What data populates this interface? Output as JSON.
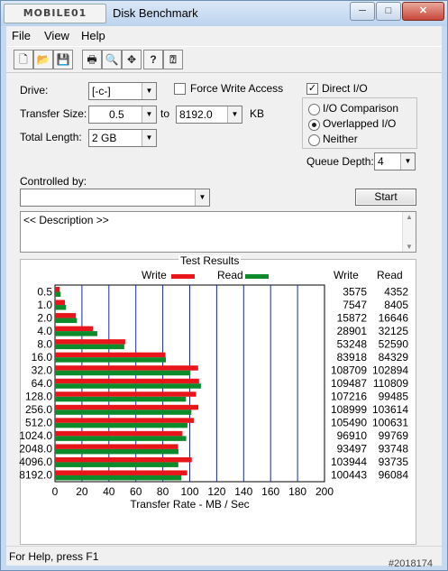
{
  "window": {
    "logo_text": "MOBILE01",
    "title": "Disk Benchmark",
    "controls": {
      "minimize": "─",
      "maximize": "□",
      "close": "✕"
    }
  },
  "menu": [
    "File",
    "View",
    "Help"
  ],
  "toolbar": {
    "icons": [
      "new-icon",
      "open-icon",
      "save-icon",
      "print-icon",
      "print-preview-icon",
      "move-icon",
      "help-icon",
      "context-help-icon"
    ],
    "glyphs": [
      "🗋",
      "📂",
      "💾",
      "🖶",
      "🔍",
      "✥",
      "?",
      "⍰"
    ]
  },
  "settings": {
    "drive_label": "Drive:",
    "drive_value": "[-c-]",
    "transfer_size_label": "Transfer Size:",
    "transfer_from": "0.5",
    "to_label": "to",
    "transfer_to": "8192.0",
    "kb_label": "KB",
    "total_length_label": "Total Length:",
    "total_length_value": "2 GB",
    "force_write_access_label": "Force Write Access",
    "force_write_access_checked": false,
    "direct_io_label": "Direct I/O",
    "direct_io_checked": true,
    "io_options": [
      {
        "label": "I/O Comparison",
        "selected": false
      },
      {
        "label": "Overlapped I/O",
        "selected": true
      },
      {
        "label": "Neither",
        "selected": false
      }
    ],
    "queue_depth_label": "Queue Depth:",
    "queue_depth_value": "4",
    "controlled_by_label": "Controlled by:",
    "controlled_by_value": "",
    "start_label": "Start",
    "description_text": "<< Description >>"
  },
  "results": {
    "group_title": "Test Results",
    "write_label": "Write",
    "read_label": "Read",
    "write_color": "#e8151b",
    "read_color": "#0d8a2a",
    "col_write_header": "Write",
    "col_read_header": "Read",
    "x_axis_label": "Transfer Rate - MB / Sec"
  },
  "chart_data": {
    "type": "bar",
    "orientation": "horizontal",
    "categories": [
      "0.5",
      "1.0",
      "2.0",
      "4.0",
      "8.0",
      "16.0",
      "32.0",
      "64.0",
      "128.0",
      "256.0",
      "512.0",
      "1024.0",
      "2048.0",
      "4096.0",
      "8192.0"
    ],
    "series": [
      {
        "name": "Write",
        "values": [
          3.5,
          7.4,
          15.5,
          28.2,
          52.1,
          82.0,
          106.2,
          106.9,
          104.7,
          106.4,
          103.0,
          94.6,
          91.3,
          101.5,
          98.1
        ]
      },
      {
        "name": "Read",
        "values": [
          4.2,
          8.2,
          16.3,
          31.4,
          51.4,
          82.3,
          100.5,
          108.3,
          97.2,
          101.2,
          98.3,
          97.4,
          91.6,
          91.5,
          93.8
        ]
      }
    ],
    "xlim": [
      0,
      200
    ],
    "xticks": [
      "0",
      "20",
      "40",
      "60",
      "80",
      "100",
      "120",
      "140",
      "160",
      "180",
      "200"
    ],
    "xlabel": "Transfer Rate - MB / Sec",
    "legend_position": "top",
    "grid": true,
    "table": {
      "write": [
        "3575",
        "7547",
        "15872",
        "28901",
        "53248",
        "83918",
        "108709",
        "109487",
        "107216",
        "108999",
        "105490",
        "96910",
        "93497",
        "103944",
        "100443"
      ],
      "read": [
        "4352",
        "8405",
        "16646",
        "32125",
        "52590",
        "84329",
        "102894",
        "110809",
        "99485",
        "103614",
        "100631",
        "99769",
        "93748",
        "93735",
        "96084"
      ]
    }
  },
  "status": {
    "text": "For Help, press F1",
    "watermark": "#2018174"
  }
}
